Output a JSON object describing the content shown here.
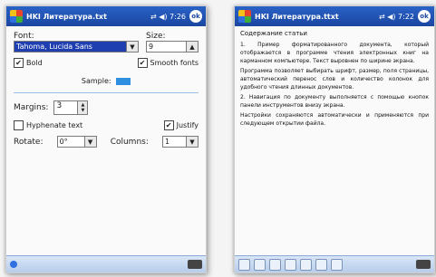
{
  "left": {
    "titlebar": {
      "title": "HKI Литература.txt",
      "status": "⇄ ◀) 7:26",
      "ok": "ok"
    },
    "font": {
      "label": "Font:",
      "value": "Tahoma, Lucida Sans"
    },
    "size": {
      "label": "Size:",
      "value": "9"
    },
    "bold": {
      "label": "Bold",
      "checked": true
    },
    "smooth": {
      "label": "Smooth fonts",
      "checked": true
    },
    "sample": {
      "label": "Sample:",
      "color": "#2f8fe0"
    },
    "margins": {
      "label": "Margins:",
      "value": "3"
    },
    "hyphenate": {
      "label": "Hyphenate text",
      "checked": false
    },
    "justify": {
      "label": "Justify",
      "checked": true
    },
    "rotate": {
      "label": "Rotate:",
      "value": "0°"
    },
    "columns": {
      "label": "Columns:",
      "value": "1"
    }
  },
  "right": {
    "titlebar": {
      "title": "HKI Литература.ttxt",
      "status": "⇄ ◀) 7:22",
      "ok": "ok"
    },
    "doc_title": "Содержание статьи",
    "paragraphs": [
      "1. Пример форматированного документа, который отображается в программе чтения электронных книг на карманном компьютере. Текст выровнен по ширине экрана.",
      "Программа позволяет выбирать шрифт, размер, поля страницы, автоматический перенос слов и количество колонок для удобного чтения длинных документов.",
      "2. Навигация по документу выполняется с помощью кнопок панели инструментов внизу экрана.",
      "Настройки сохраняются автоматически и применяются при следующем открытии файла."
    ]
  }
}
